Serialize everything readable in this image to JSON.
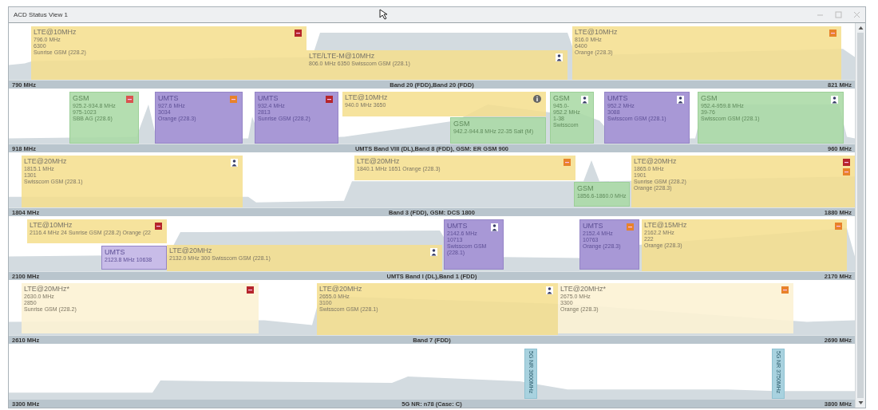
{
  "window": {
    "title": "ACD Status View 1"
  },
  "bands": [
    {
      "start": "790 MHz",
      "name": "Band 20 (FDD),Band 20 (FDD)",
      "end": "821 MHz",
      "blocks": [
        {
          "kind": "lte",
          "dimmed": false,
          "title": "LTE@10MHz",
          "lines": [
            "796.0 MHz",
            "6300",
            "Sunrise GSM (228.2)"
          ],
          "badges": [
            {
              "kind": "square",
              "color": "#b5252b"
            }
          ]
        },
        {
          "kind": "lte",
          "dimmed": false,
          "title": "LTE/LTE-M@10MHz",
          "lines": [
            "806.0 MHz  6350  Swisscom GSM (228.1)"
          ],
          "badges": [
            {
              "kind": "person"
            }
          ]
        },
        {
          "kind": "lte",
          "dimmed": false,
          "title": "LTE@10MHz",
          "lines": [
            "816.0 MHz",
            "6400",
            "Orange (228.3)"
          ],
          "badges": [
            {
              "kind": "square",
              "color": "#e8822a"
            }
          ]
        }
      ]
    },
    {
      "start": "918 MHz",
      "name": "UMTS Band VIII (DL),Band 8 (FDD), GSM: ER GSM 900",
      "end": "960 MHz",
      "blocks": [
        {
          "kind": "gsm",
          "dimmed": false,
          "title": "GSM",
          "lines": [
            "925.2-934.8 MHz",
            "975-1023",
            "SBB AG (228.6)"
          ],
          "badges": [
            {
              "kind": "square",
              "color": "#d9534f"
            }
          ]
        },
        {
          "kind": "umts",
          "dimmed": false,
          "title": "UMTS",
          "lines": [
            "927.6 MHz",
            "3034",
            "Orange (228.3)"
          ],
          "badges": [
            {
              "kind": "square",
              "color": "#e8822a"
            }
          ]
        },
        {
          "kind": "umts",
          "dimmed": false,
          "title": "UMTS",
          "lines": [
            "932.4 MHz",
            "2813",
            "Sunrise GSM (228.2)"
          ],
          "badges": [
            {
              "kind": "square",
              "color": "#b5252b"
            }
          ]
        },
        {
          "kind": "lte",
          "dimmed": false,
          "title": "LTE@10MHz",
          "lines": [
            "940.0 MHz  3650"
          ],
          "badges": [
            {
              "kind": "info"
            }
          ]
        },
        {
          "kind": "gsm",
          "dimmed": false,
          "title": "GSM",
          "lines": [
            "942.2-944.8 MHz  22-35  Salt (M)"
          ]
        },
        {
          "kind": "gsm",
          "dimmed": false,
          "title": "GSM",
          "lines": [
            "945.0-",
            "952.2 MHz",
            "1-38",
            "Swisscom"
          ],
          "badges": [
            {
              "kind": "person"
            }
          ]
        },
        {
          "kind": "umts",
          "dimmed": false,
          "title": "UMTS",
          "lines": [
            "952.2 MHz",
            "3088",
            "Swisscom GSM (228.1)"
          ],
          "badges": [
            {
              "kind": "person"
            }
          ]
        },
        {
          "kind": "gsm",
          "dimmed": false,
          "title": "GSM",
          "lines": [
            "952.4-959.8 MHz",
            "39-76",
            "Swisscom GSM (228.1)"
          ],
          "badges": [
            {
              "kind": "person"
            }
          ]
        }
      ]
    },
    {
      "start": "1804 MHz",
      "name": "Band 3 (FDD), GSM: DCS 1800",
      "end": "1880 MHz",
      "blocks": [
        {
          "kind": "lte",
          "dimmed": false,
          "title": "LTE@20MHz",
          "lines": [
            "1815.1 MHz",
            "1301",
            "Swisscom GSM (228.1)"
          ],
          "badges": [
            {
              "kind": "person"
            }
          ]
        },
        {
          "kind": "lte",
          "dimmed": false,
          "title": "LTE@20MHz",
          "lines": [
            "1840.1 MHz  1651  Orange (228.3)"
          ],
          "badges": [
            {
              "kind": "square",
              "color": "#e8822a"
            }
          ]
        },
        {
          "kind": "gsm",
          "dimmed": false,
          "title": "GSM",
          "lines": [
            "1856.6-1860.0 MHz"
          ]
        },
        {
          "kind": "lte",
          "dimmed": false,
          "title": "LTE@20MHz",
          "lines": [
            "1865.0 MHz",
            "1901",
            "Sunrise GSM (228.2)",
            "Orange (228.3)"
          ],
          "badges": [
            {
              "kind": "square",
              "color": "#b5252b"
            },
            {
              "kind": "square",
              "color": "#e8822a"
            }
          ]
        }
      ]
    },
    {
      "start": "2100 MHz",
      "name": "UMTS Band I (DL),Band 1 (FDD)",
      "end": "2170 MHz",
      "blocks": [
        {
          "kind": "lte",
          "dimmed": false,
          "title": "LTE@10MHz",
          "lines": [
            "2116.4 MHz  24  Sunrise GSM (228.2)  Orange (22"
          ],
          "badges": [
            {
              "kind": "square",
              "color": "#b5252b"
            }
          ]
        },
        {
          "kind": "umts",
          "dimmed": true,
          "title": "UMTS",
          "lines": [
            "2123.8 MHz  10638"
          ]
        },
        {
          "kind": "lte",
          "dimmed": false,
          "title": "LTE@20MHz",
          "lines": [
            "2132.0 MHz  300  Swisscom GSM (228.1)"
          ],
          "badges": [
            {
              "kind": "person"
            }
          ]
        },
        {
          "kind": "umts",
          "dimmed": false,
          "title": "UMTS",
          "lines": [
            "2142.6 MHz",
            "10713",
            "Swisscom GSM",
            "(228.1)"
          ],
          "badges": [
            {
              "kind": "person"
            }
          ]
        },
        {
          "kind": "umts",
          "dimmed": false,
          "title": "UMTS",
          "lines": [
            "2152.4 MHz",
            "10763",
            "Orange (228.3)"
          ],
          "badges": [
            {
              "kind": "square",
              "color": "#e8822a"
            }
          ]
        },
        {
          "kind": "lte",
          "dimmed": false,
          "title": "LTE@15MHz",
          "lines": [
            "2162.2 MHz",
            "222",
            "Orange (228.3)"
          ],
          "badges": [
            {
              "kind": "square",
              "color": "#e8822a"
            }
          ]
        }
      ]
    },
    {
      "start": "2610 MHz",
      "name": "Band 7 (FDD)",
      "end": "2690 MHz",
      "blocks": [
        {
          "kind": "lte",
          "dimmed": true,
          "title": "LTE@20MHz*",
          "lines": [
            "2630.0 MHz",
            "2850",
            "Sunrise GSM (228.2)"
          ],
          "badges": [
            {
              "kind": "square",
              "color": "#b5252b"
            }
          ]
        },
        {
          "kind": "lte",
          "dimmed": false,
          "title": "LTE@20MHz",
          "lines": [
            "2655.0 MHz",
            "3100",
            "Swisscom GSM (228.1)"
          ],
          "badges": [
            {
              "kind": "person"
            }
          ]
        },
        {
          "kind": "lte",
          "dimmed": true,
          "title": "LTE@20MHz*",
          "lines": [
            "2675.0 MHz",
            "3300",
            "Orange (228.3)"
          ],
          "badges": [
            {
              "kind": "square",
              "color": "#e8822a"
            }
          ]
        }
      ]
    },
    {
      "start": "3300 MHz",
      "name": "5G NR: n78 (Case: C)",
      "end": "3800 MHz",
      "blocks": [
        {
          "kind": "nr",
          "dimmed": false,
          "title": "5G NR 3600MHz"
        },
        {
          "kind": "nr",
          "dimmed": false,
          "title": "5G NR 3750MHz"
        }
      ]
    }
  ]
}
